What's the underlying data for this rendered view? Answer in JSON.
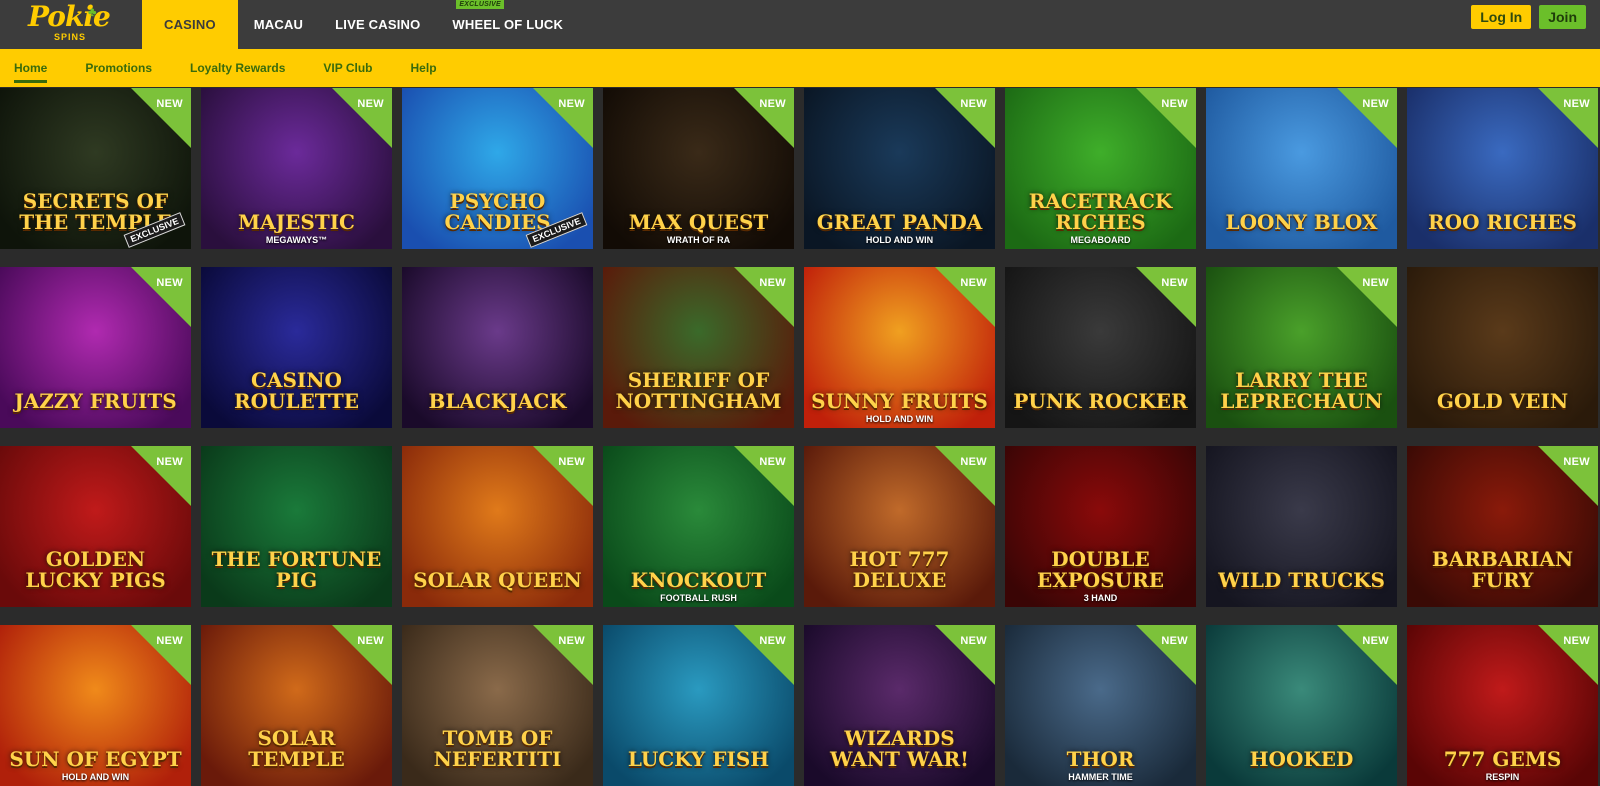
{
  "brand": {
    "name": "Pokie",
    "sub": "SPINS"
  },
  "main_nav": [
    {
      "label": "CASINO",
      "active": true,
      "badge": ""
    },
    {
      "label": "MACAU",
      "active": false,
      "badge": ""
    },
    {
      "label": "LIVE CASINO",
      "active": false,
      "badge": ""
    },
    {
      "label": "WHEEL OF LUCK",
      "active": false,
      "badge": "EXCLUSIVE"
    }
  ],
  "auth": {
    "login_label": "Log In",
    "join_label": "Join"
  },
  "sub_nav": [
    {
      "label": "Home",
      "active": true
    },
    {
      "label": "Promotions",
      "active": false
    },
    {
      "label": "Loyalty Rewards",
      "active": false
    },
    {
      "label": "VIP Club",
      "active": false
    },
    {
      "label": "Help",
      "active": false
    }
  ],
  "colors": {
    "brand_yellow": "#ffcc00",
    "brand_green": "#6bbf2a",
    "bar_dark": "#3c3c3c",
    "page_bg": "#2b2b2b"
  },
  "games": [
    {
      "title": "SECRETS OF THE TEMPLE",
      "sub": "",
      "badge": "NEW",
      "exclusive": "EXCLUSIVE",
      "bg": [
        "#2f3a22",
        "#0e140a"
      ]
    },
    {
      "title": "MAJESTIC",
      "sub": "MEGAWAYS™",
      "badge": "NEW",
      "exclusive": "",
      "bg": [
        "#6b2a9a",
        "#2a0f3d"
      ]
    },
    {
      "title": "Psycho CANDIES",
      "sub": "",
      "badge": "NEW",
      "exclusive": "EXCLUSIVE",
      "bg": [
        "#2fa8e8",
        "#1a4fb0"
      ]
    },
    {
      "title": "MAX QUEST",
      "sub": "WRATH OF RA",
      "badge": "NEW",
      "exclusive": "",
      "bg": [
        "#3a2a18",
        "#120b05"
      ]
    },
    {
      "title": "GREAT PANDA",
      "sub": "HOLD AND WIN",
      "badge": "NEW",
      "exclusive": "",
      "bg": [
        "#1a3a5a",
        "#0a1624"
      ]
    },
    {
      "title": "RACETRACK RICHES",
      "sub": "MEGABOARD",
      "badge": "NEW",
      "exclusive": "",
      "bg": [
        "#3fae2a",
        "#1c6a14"
      ]
    },
    {
      "title": "LOONY BLOX",
      "sub": "",
      "badge": "NEW",
      "exclusive": "",
      "bg": [
        "#4a9ae0",
        "#1f5aa0"
      ]
    },
    {
      "title": "ROO RICHES",
      "sub": "",
      "badge": "NEW",
      "exclusive": "",
      "bg": [
        "#3a6ac0",
        "#1a2f6a"
      ]
    },
    {
      "title": "Jazzy Fruits",
      "sub": "",
      "badge": "NEW",
      "exclusive": "",
      "bg": [
        "#b02ab0",
        "#4a0a5a"
      ]
    },
    {
      "title": "CASINO ROULETTE",
      "sub": "",
      "badge": "",
      "exclusive": "",
      "bg": [
        "#2a2a9a",
        "#0a0a3a"
      ]
    },
    {
      "title": "BLACKJACK",
      "sub": "",
      "badge": "",
      "exclusive": "",
      "bg": [
        "#6a3a8a",
        "#1a0a2a"
      ]
    },
    {
      "title": "SHERIFF OF NOTTINGHAM",
      "sub": "",
      "badge": "NEW",
      "exclusive": "",
      "bg": [
        "#3a6a2a",
        "#5a1a0a"
      ]
    },
    {
      "title": "Sunny Fruits",
      "sub": "HOLD AND WIN",
      "badge": "NEW",
      "exclusive": "",
      "bg": [
        "#f0a020",
        "#c0200a"
      ]
    },
    {
      "title": "PUNK ROCKER",
      "sub": "",
      "badge": "NEW",
      "exclusive": "",
      "bg": [
        "#3a3a3a",
        "#151515"
      ]
    },
    {
      "title": "LARRY THE LEPRECHAUN",
      "sub": "",
      "badge": "NEW",
      "exclusive": "",
      "bg": [
        "#4aa02a",
        "#1a5010"
      ]
    },
    {
      "title": "GOLD VEIN",
      "sub": "",
      "badge": "",
      "exclusive": "",
      "bg": [
        "#5a3a1a",
        "#2a1a0a"
      ]
    },
    {
      "title": "GOLDEN LUCKY PIGS",
      "sub": "",
      "badge": "NEW",
      "exclusive": "",
      "bg": [
        "#c01a1a",
        "#6a0a0a"
      ]
    },
    {
      "title": "The Fortune Pig",
      "sub": "",
      "badge": "",
      "exclusive": "",
      "bg": [
        "#1a7a3a",
        "#0a3a1a"
      ]
    },
    {
      "title": "SOLAR QUEEN",
      "sub": "",
      "badge": "NEW",
      "exclusive": "",
      "bg": [
        "#e07a1a",
        "#8a2a0a"
      ]
    },
    {
      "title": "KNOCKOUT",
      "sub": "FOOTBALL RUSH",
      "badge": "NEW",
      "exclusive": "",
      "bg": [
        "#2a8a3a",
        "#0a4a1a"
      ]
    },
    {
      "title": "HOT 777 DELUXE",
      "sub": "",
      "badge": "NEW",
      "exclusive": "",
      "bg": [
        "#c06a2a",
        "#5a1a0a"
      ]
    },
    {
      "title": "Double Exposure",
      "sub": "3 HAND",
      "badge": "",
      "exclusive": "",
      "bg": [
        "#8a0a0a",
        "#3a0505"
      ]
    },
    {
      "title": "WILD TRUCKS",
      "sub": "",
      "badge": "",
      "exclusive": "",
      "bg": [
        "#3a3a4a",
        "#151520"
      ]
    },
    {
      "title": "BARBARIAN FURY",
      "sub": "",
      "badge": "NEW",
      "exclusive": "",
      "bg": [
        "#8a1a0a",
        "#3a0a05"
      ]
    },
    {
      "title": "SUN OF EGYPT",
      "sub": "HOLD AND WIN",
      "badge": "NEW",
      "exclusive": "",
      "bg": [
        "#f08a1a",
        "#b0200a"
      ]
    },
    {
      "title": "SOLAR TEMPLE",
      "sub": "",
      "badge": "NEW",
      "exclusive": "",
      "bg": [
        "#d06a1a",
        "#6a1a0a"
      ]
    },
    {
      "title": "Tomb Of Nefertiti",
      "sub": "",
      "badge": "NEW",
      "exclusive": "",
      "bg": [
        "#8a6a4a",
        "#3a2a1a"
      ]
    },
    {
      "title": "Lucky Fish",
      "sub": "",
      "badge": "NEW",
      "exclusive": "",
      "bg": [
        "#2a9ac0",
        "#0a4a6a"
      ]
    },
    {
      "title": "WIZARDS WANT WAR!",
      "sub": "",
      "badge": "NEW",
      "exclusive": "",
      "bg": [
        "#5a2a6a",
        "#1a0a2a"
      ]
    },
    {
      "title": "THOR",
      "sub": "HAMMER TIME",
      "badge": "NEW",
      "exclusive": "",
      "bg": [
        "#4a6a8a",
        "#1a2a3a"
      ]
    },
    {
      "title": "HOOKED",
      "sub": "",
      "badge": "NEW",
      "exclusive": "",
      "bg": [
        "#3a8a7a",
        "#0a3a3a"
      ]
    },
    {
      "title": "777 GEMS",
      "sub": "RESPIN",
      "badge": "NEW",
      "exclusive": "",
      "bg": [
        "#c01a1a",
        "#5a0505"
      ]
    }
  ]
}
